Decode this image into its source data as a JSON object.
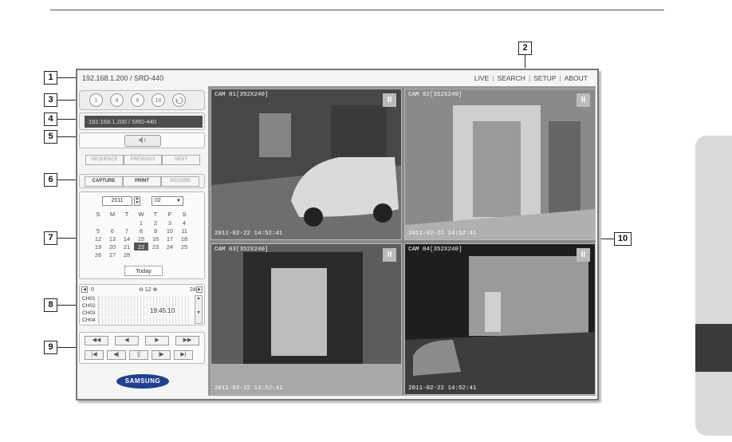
{
  "window": {
    "address": "192.168.1.200 / SRD-440",
    "nav": [
      "LIVE",
      "SEARCH",
      "SETUP",
      "ABOUT"
    ],
    "nav_separator": "|"
  },
  "split_buttons": [
    "1",
    "4",
    "9",
    "16",
    "auto"
  ],
  "device_field": "192.168.1.200  / SRD-440",
  "audio": {
    "icon": "speaker-icon"
  },
  "sequence_buttons": [
    "SEQUENCE",
    "PREVIOUS",
    "NEXT"
  ],
  "capture_buttons": [
    "CAPTURE",
    "PRINT",
    "RECORD"
  ],
  "calendar": {
    "year": "2011",
    "month": "02",
    "weekdays": [
      "S",
      "M",
      "T",
      "W",
      "T",
      "F",
      "S"
    ],
    "weeks": [
      [
        "",
        "",
        "",
        "1",
        "2",
        "3",
        "4"
      ],
      [
        "5",
        "6",
        "7",
        "8",
        "9",
        "10",
        "11"
      ],
      [
        "12",
        "13",
        "14",
        "15",
        "16",
        "17",
        "18"
      ],
      [
        "19",
        "20",
        "21",
        "22",
        "23",
        "24",
        "25"
      ],
      [
        "26",
        "27",
        "28",
        "",
        "",
        "",
        ""
      ]
    ],
    "selected_day": "22",
    "today_label": "Today"
  },
  "timeline": {
    "start": "0",
    "mid": "12",
    "end": "24",
    "channels": [
      "CH01",
      "CH02",
      "CH03",
      "CH04"
    ],
    "time": "19:45:10"
  },
  "playback": {
    "row1": [
      "◀◀",
      "◀",
      "▶",
      "▶▶"
    ],
    "row2": [
      "|◀",
      "◀|",
      "||",
      "|▶",
      "▶|"
    ]
  },
  "logo": "SAMSUNG",
  "cameras": [
    {
      "label": "CAM 01[352X240]",
      "timestamp": "2011-02-22 14:52:41"
    },
    {
      "label": "CAM 02[352X240]",
      "timestamp": "2011-02-22 14:52:41"
    },
    {
      "label": "CAM 03[352X240]",
      "timestamp": "2011-02-22 14:52:41"
    },
    {
      "label": "CAM 04[352X240]",
      "timestamp": "2011-02-22 14:52:41"
    }
  ],
  "callouts": [
    "1",
    "2",
    "3",
    "4",
    "5",
    "6",
    "7",
    "8",
    "9",
    "10"
  ]
}
